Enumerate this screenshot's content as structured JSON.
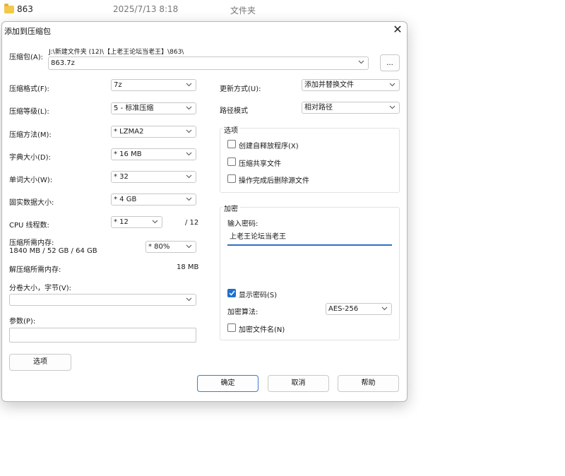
{
  "background": {
    "folder_name": "863",
    "date": "2025/7/13 8:18",
    "type": "文件夹"
  },
  "dialog": {
    "title": "添加到压缩包",
    "close_glyph": "✕",
    "archive_label": "压缩包(A):",
    "archive_path": "J:\\新建文件夹 (12)\\【上老王论坛当老王】\\863\\",
    "archive_name": "863.7z",
    "browse_label": "...",
    "left": {
      "format_label": "压缩格式(F):",
      "format_value": "7z",
      "level_label": "压缩等级(L):",
      "level_value": "5 - 标准压缩",
      "method_label": "压缩方法(M):",
      "method_value": "*  LZMA2",
      "dict_label": "字典大小(D):",
      "dict_value": "*  16 MB",
      "word_label": "单词大小(W):",
      "word_value": "*  32",
      "solid_label": "固实数据大小:",
      "solid_value": "*  4 GB",
      "threads_label": "CPU 线程数:",
      "threads_value": "*  12",
      "threads_total": "/ 12",
      "mem_label": "压缩所需内存:",
      "mem_detail": "1840 MB / 52 GB / 64 GB",
      "mem_value": "*  80%",
      "decomp_mem_label": "解压缩所需内存:",
      "decomp_mem_value": "18 MB",
      "split_label": "分卷大小，字节(V):",
      "split_value": "",
      "params_label": "参数(P):",
      "params_value": "",
      "options_button": "选项"
    },
    "right": {
      "update_label": "更新方式(U):",
      "update_value": "添加并替换文件",
      "path_label": "路径模式",
      "path_value": "相对路径",
      "options_group": "选项",
      "opt_sfx": "创建自释放程序(X)",
      "opt_shared": "压缩共享文件",
      "opt_delete": "操作完成后删除源文件",
      "encrypt_group": "加密",
      "password_label": "输入密码:",
      "password_value": "上老王论坛当老王",
      "show_password": "显示密码(S)",
      "show_password_checked": true,
      "enc_method_label": "加密算法:",
      "enc_method_value": "AES-256",
      "encrypt_names": "加密文件名(N)"
    },
    "buttons": {
      "ok": "确定",
      "cancel": "取消",
      "help": "帮助"
    }
  }
}
